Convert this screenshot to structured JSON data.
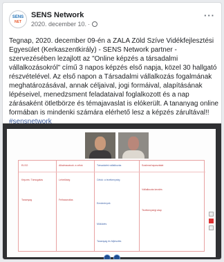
{
  "post": {
    "page_name": "SENS Network",
    "date": "2020. december 10.",
    "separator": "·",
    "avatar": {
      "line1": "SENS",
      "line2": "NET"
    },
    "more_label": "···",
    "text": "Tegnap, 2020. december 09-én a ZALA Zöld Szíve Vidékfejlesztési Egyesület (Kerkaszentkirály) - SENS Network partner - szervezésében lezajlott az \"Online képzés a társadalmi vállalkozásokról\" című 3 napos képzés első napja, közel 30 hallgató részvételével. Az első napon a Társadalmi vállalkozás fogalmának meghatározásával, annak céljaival, jogi formáival, alapításának lépéseivel, menedzsment feladataival foglalkozott és a nap zárásaként ötletbörze és témajavaslat is elókerült. A tananyag online formában is mindenki számára elérhető lesz a képzés zárultával!!",
    "hashtag": "#sensnetwork"
  },
  "media": {
    "doc_cells": [
      "ELSŐ",
      "Alkalmazások: a célok",
      "Szakmai tapasztalat",
      "Képzés: Támogatás",
      "Lehetőség",
      "Vállalkozás kezdés",
      "Tananyag",
      "Felhasználás",
      "Tevékenységi alap"
    ],
    "doc_cells_blue": [
      "Társadalmi vállalkozás",
      "Célok: a tevékenység",
      "Eredmények",
      "Működés",
      "Tananyag és fejlesztés"
    ]
  },
  "colors": {
    "accent_link": "#385898",
    "doc_red": "#c23a3a",
    "doc_blue": "#3c62a8",
    "media_bg": "#2f3033"
  },
  "icons": [
    "globe-icon",
    "more-options-icon"
  ]
}
